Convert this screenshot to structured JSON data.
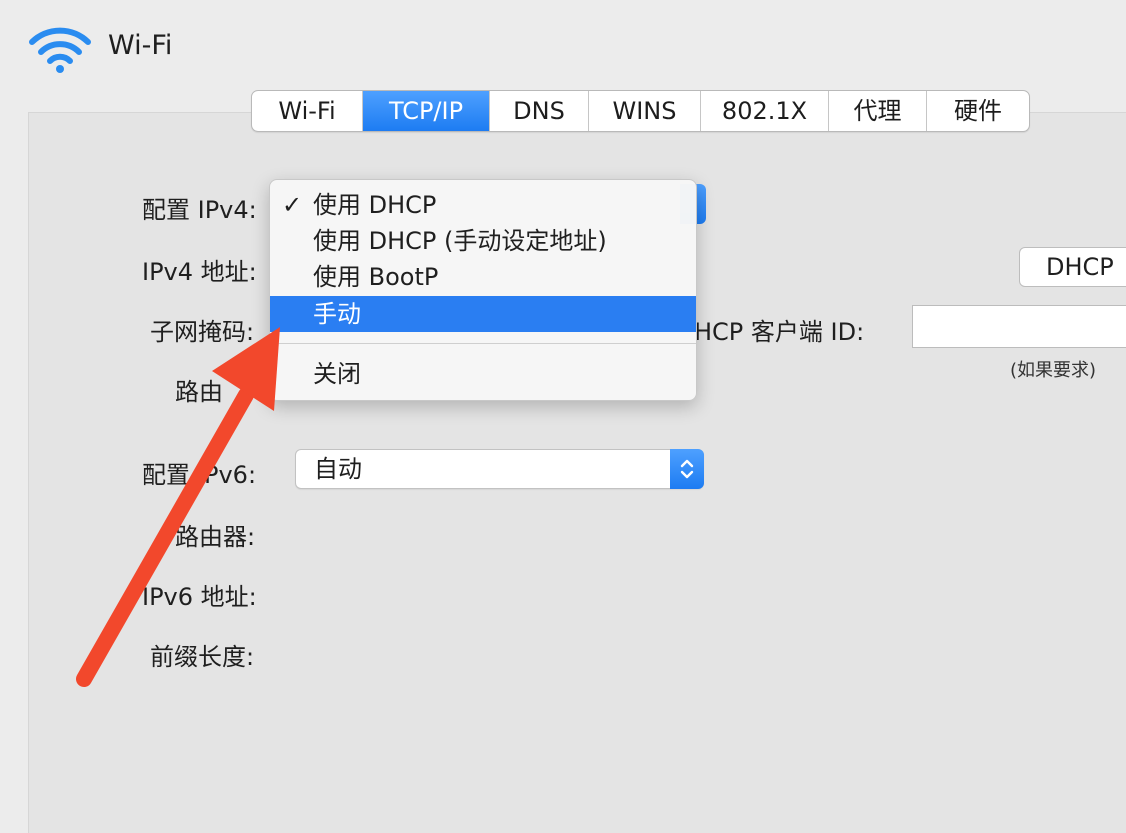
{
  "window": {
    "title": "Wi-Fi"
  },
  "tabs": [
    {
      "label": "Wi-Fi",
      "active": false
    },
    {
      "label": "TCP/IP",
      "active": true
    },
    {
      "label": "DNS",
      "active": false
    },
    {
      "label": "WINS",
      "active": false
    },
    {
      "label": "802.1X",
      "active": false
    },
    {
      "label": "代理",
      "active": false
    },
    {
      "label": "硬件",
      "active": false
    }
  ],
  "form": {
    "configure_ipv4_label": "配置 IPv4:",
    "ipv4_address_label": "IPv4 地址:",
    "subnet_mask_label": "子网掩码:",
    "router_label_partial": "路由",
    "router_label_suffix": ":",
    "dhcp_client_id_label": "HCP 客户端 ID:",
    "dhcp_client_id_note": "(如果要求)",
    "dhcp_button_label": "DHCP",
    "configure_ipv6_label_prefix": "配置",
    "configure_ipv6_label_suffix": "Pv6:",
    "configure_ipv6_value": "自动",
    "ipv6_router_label": "路由器:",
    "ipv6_address_label": "IPv6 地址:",
    "prefix_length_label": "前缀长度:"
  },
  "ipv4_menu": {
    "items": [
      {
        "label": "使用 DHCP",
        "checked": true
      },
      {
        "label": "使用 DHCP (手动设定地址)",
        "checked": false
      },
      {
        "label": "使用 BootP",
        "checked": false
      },
      {
        "label": "手动",
        "highlighted": true
      },
      {
        "label": "关闭",
        "checked": false
      }
    ],
    "check_glyph": "✓"
  },
  "colors": {
    "accent": "#2a7ef2",
    "annotation_arrow": "#f2482c"
  },
  "icons": {
    "wifi": "wifi-icon",
    "stepper": "up-down-chevron-icon",
    "check": "checkmark-icon",
    "annotation": "arrow-annotation"
  }
}
